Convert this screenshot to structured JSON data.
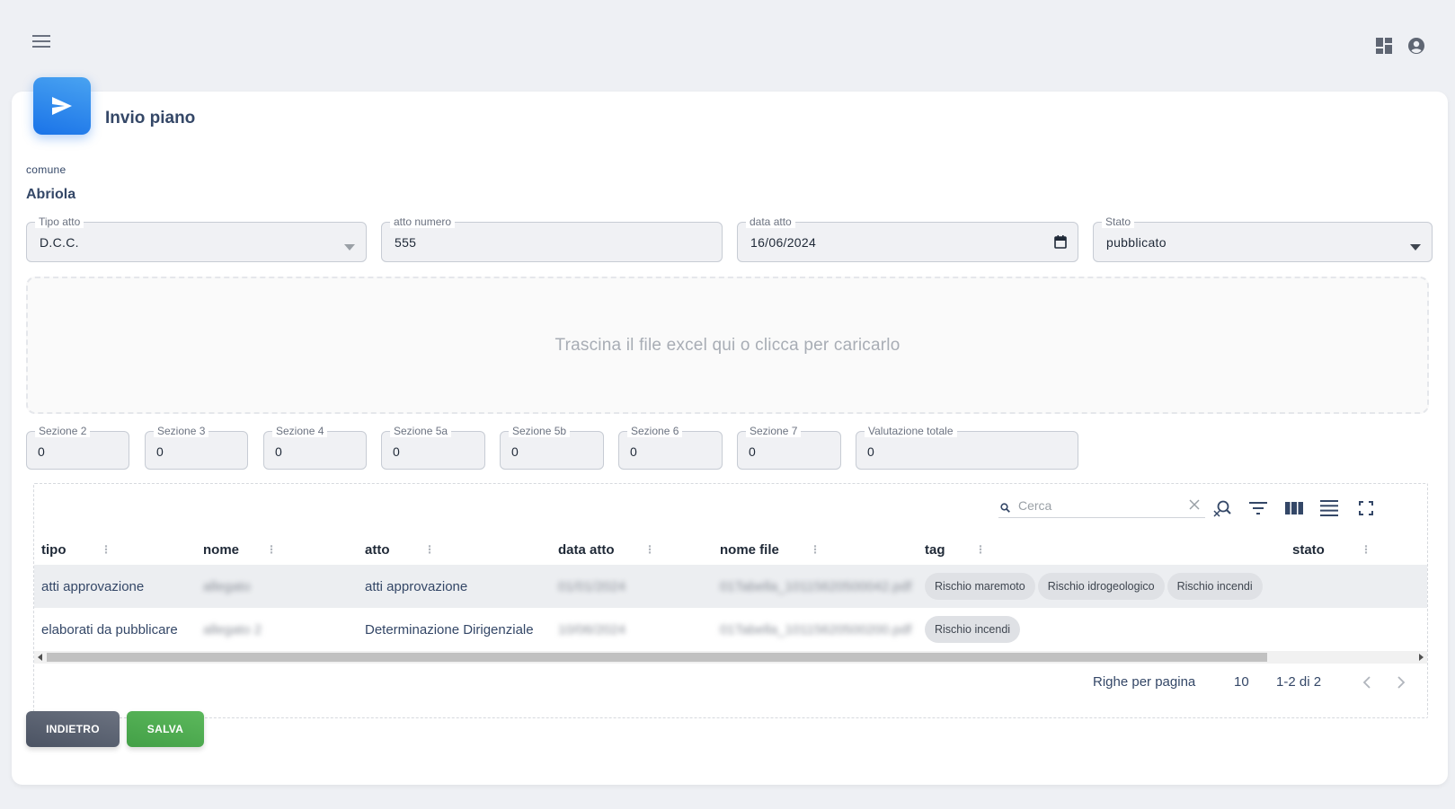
{
  "topbar": {
    "menu_icon": "menu-icon",
    "dashboard_icon": "dashboard-icon",
    "account_icon": "account-circle-icon"
  },
  "header": {
    "icon": "send-icon",
    "title": "Invio piano"
  },
  "comune": {
    "label": "comune",
    "value": "Abriola"
  },
  "form": {
    "tipo_atto": {
      "label": "Tipo atto",
      "value": "D.C.C."
    },
    "atto_numero": {
      "label": "atto numero",
      "value": "555"
    },
    "data_atto": {
      "label": "data atto",
      "value": "16/06/2024"
    },
    "stato": {
      "label": "Stato",
      "value": "pubblicato"
    }
  },
  "dropzone": {
    "text": "Trascina il file excel qui o clicca per caricarlo"
  },
  "sections": [
    {
      "label": "Sezione 2",
      "value": "0"
    },
    {
      "label": "Sezione 3",
      "value": "0"
    },
    {
      "label": "Sezione 4",
      "value": "0"
    },
    {
      "label": "Sezione 5a",
      "value": "0"
    },
    {
      "label": "Sezione 5b",
      "value": "0"
    },
    {
      "label": "Sezione 6",
      "value": "0"
    },
    {
      "label": "Sezione 7",
      "value": "0"
    },
    {
      "label": "Valutazione totale",
      "value": "0"
    }
  ],
  "table": {
    "search_placeholder": "Cerca",
    "columns": [
      "tipo",
      "nome",
      "atto",
      "data atto",
      "nome file",
      "tag",
      "stato"
    ],
    "rows": [
      {
        "tipo": "atti approvazione",
        "nome": "allegato",
        "atto": "atti approvazione",
        "data_atto": "01/01/2024",
        "nome_file": "01Tabella_10115620500042.pdf",
        "tags": [
          "Rischio maremoto",
          "Rischio idrogeologico",
          "Rischio incendi"
        ],
        "stato": ""
      },
      {
        "tipo": "elaborati da pubblicare",
        "nome": "allegato 2",
        "atto": "Determinazione Dirigenziale",
        "data_atto": "10/06/2024",
        "nome_file": "01Tabella_10115620500200.pdf",
        "tags": [
          "Rischio incendi"
        ],
        "stato": ""
      }
    ],
    "pagination": {
      "rows_per_page_label": "Righe per pagina",
      "rows_per_page": "10",
      "range": "1-2 di 2"
    }
  },
  "actions": {
    "back_label": "INDIETRO",
    "save_label": "SALVA"
  },
  "colors": {
    "primary": "#1a73e8",
    "success": "#4caf50",
    "secondary": "#5f6673",
    "background": "#eef0f4"
  }
}
